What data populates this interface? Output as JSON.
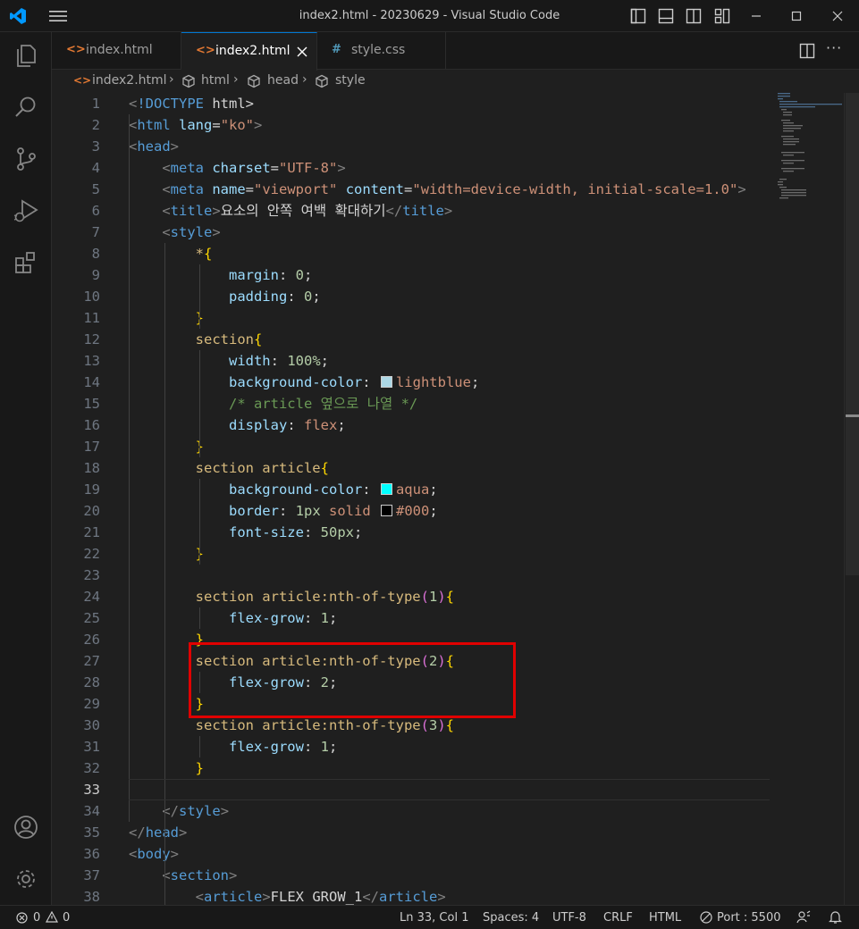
{
  "window": {
    "title": "index2.html - 20230629 - Visual Studio Code"
  },
  "tabs": [
    {
      "label": "index.html",
      "icon": "html-file-icon",
      "active": false
    },
    {
      "label": "index2.html",
      "icon": "html-file-icon",
      "active": true
    },
    {
      "label": "style.css",
      "icon": "css-file-icon",
      "active": false
    }
  ],
  "breadcrumb": [
    "index2.html",
    "html",
    "head",
    "style"
  ],
  "status": {
    "errors": "0",
    "warnings": "0",
    "position": "Ln 33, Col 1",
    "spaces": "Spaces: 4",
    "encoding": "UTF-8",
    "eol": "CRLF",
    "language": "HTML",
    "port": "Port : 5500"
  },
  "colors": {
    "lightblue": "#add8e6",
    "aqua": "#00ffff",
    "black": "#000000",
    "highlight_box": "#e00000",
    "accent": "#0078d4"
  },
  "editor": {
    "current_line": 33,
    "lines": [
      {
        "n": "1",
        "code": "<!DOCTYPE html>"
      },
      {
        "n": "2",
        "code": "<html lang=\"ko\">"
      },
      {
        "n": "3",
        "code": "<head>"
      },
      {
        "n": "4",
        "code": "    <meta charset=\"UTF-8\">"
      },
      {
        "n": "5",
        "code": "    <meta name=\"viewport\" content=\"width=device-width, initial-scale=1.0\">"
      },
      {
        "n": "6",
        "code": "    <title>요소의 안쪽 여백 확대하기</title>"
      },
      {
        "n": "7",
        "code": "    <style>"
      },
      {
        "n": "8",
        "code": "        *{"
      },
      {
        "n": "9",
        "code": "            margin: 0;"
      },
      {
        "n": "10",
        "code": "            padding: 0;"
      },
      {
        "n": "11",
        "code": "        }"
      },
      {
        "n": "12",
        "code": "        section{"
      },
      {
        "n": "13",
        "code": "            width: 100%;"
      },
      {
        "n": "14",
        "code": "            background-color: lightblue;"
      },
      {
        "n": "15",
        "code": "            /* article 옆으로 나열 */"
      },
      {
        "n": "16",
        "code": "            display: flex;"
      },
      {
        "n": "17",
        "code": "        }"
      },
      {
        "n": "18",
        "code": "        section article{"
      },
      {
        "n": "19",
        "code": "            background-color: aqua;"
      },
      {
        "n": "20",
        "code": "            border: 1px solid #000;"
      },
      {
        "n": "21",
        "code": "            font-size: 50px;"
      },
      {
        "n": "22",
        "code": "        }"
      },
      {
        "n": "23",
        "code": ""
      },
      {
        "n": "24",
        "code": "        section article:nth-of-type(1){"
      },
      {
        "n": "25",
        "code": "            flex-grow: 1;"
      },
      {
        "n": "26",
        "code": "        }"
      },
      {
        "n": "27",
        "code": "        section article:nth-of-type(2){"
      },
      {
        "n": "28",
        "code": "            flex-grow: 2;"
      },
      {
        "n": "29",
        "code": "        }"
      },
      {
        "n": "30",
        "code": "        section article:nth-of-type(3){"
      },
      {
        "n": "31",
        "code": "            flex-grow: 1;"
      },
      {
        "n": "32",
        "code": "        }"
      },
      {
        "n": "33",
        "code": ""
      },
      {
        "n": "34",
        "code": "    </style>"
      },
      {
        "n": "35",
        "code": "</head>"
      },
      {
        "n": "36",
        "code": "<body>"
      },
      {
        "n": "37",
        "code": "    <section>"
      },
      {
        "n": "38",
        "code": "        <article>FLEX GROW_1</article>"
      }
    ]
  }
}
